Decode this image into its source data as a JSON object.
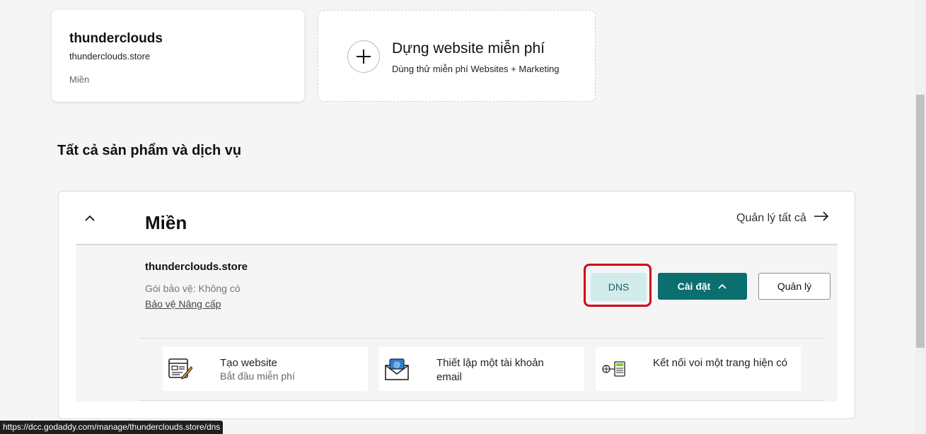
{
  "domain_card": {
    "name": "thunderclouds",
    "url": "thunderclouds.store",
    "type": "Miền"
  },
  "build_card": {
    "title": "Dựng website miễn phí",
    "subtitle": "Dùng thử miễn phí Websites + Marketing",
    "icon": "plus-icon"
  },
  "section_title": "Tất cả sản phẩm và dịch vụ",
  "panel": {
    "title": "Miền",
    "manage_all": "Quản lý tất cả",
    "collapse_icon": "chevron-up-icon",
    "arrow_icon": "arrow-right-icon"
  },
  "domain_row": {
    "name": "thunderclouds.store",
    "protection": "Gói bảo vệ: Không có",
    "upgrade_link": "Bảo vệ Nâng cấp",
    "dns_label": "DNS",
    "setup_label": "Cài đặt",
    "manage_label": "Quản lý"
  },
  "tiles": [
    {
      "title": "Tạo website",
      "subtitle": "Bắt đầu miễn phí",
      "icon": "website-builder-icon"
    },
    {
      "title": "Thiết lập một tài khoản email",
      "subtitle": "",
      "icon": "email-envelope-icon"
    },
    {
      "title": "Kết nối voi một trang hiện có",
      "subtitle": "",
      "icon": "connect-site-icon"
    }
  ],
  "status_bar": {
    "url": "https://dcc.godaddy.com/manage/thunderclouds.store/dns"
  },
  "colors": {
    "highlight": "#d0021b",
    "primary": "#0b6e6f",
    "dns_bg": "#d2ecec",
    "dns_text": "#1c5f63"
  }
}
